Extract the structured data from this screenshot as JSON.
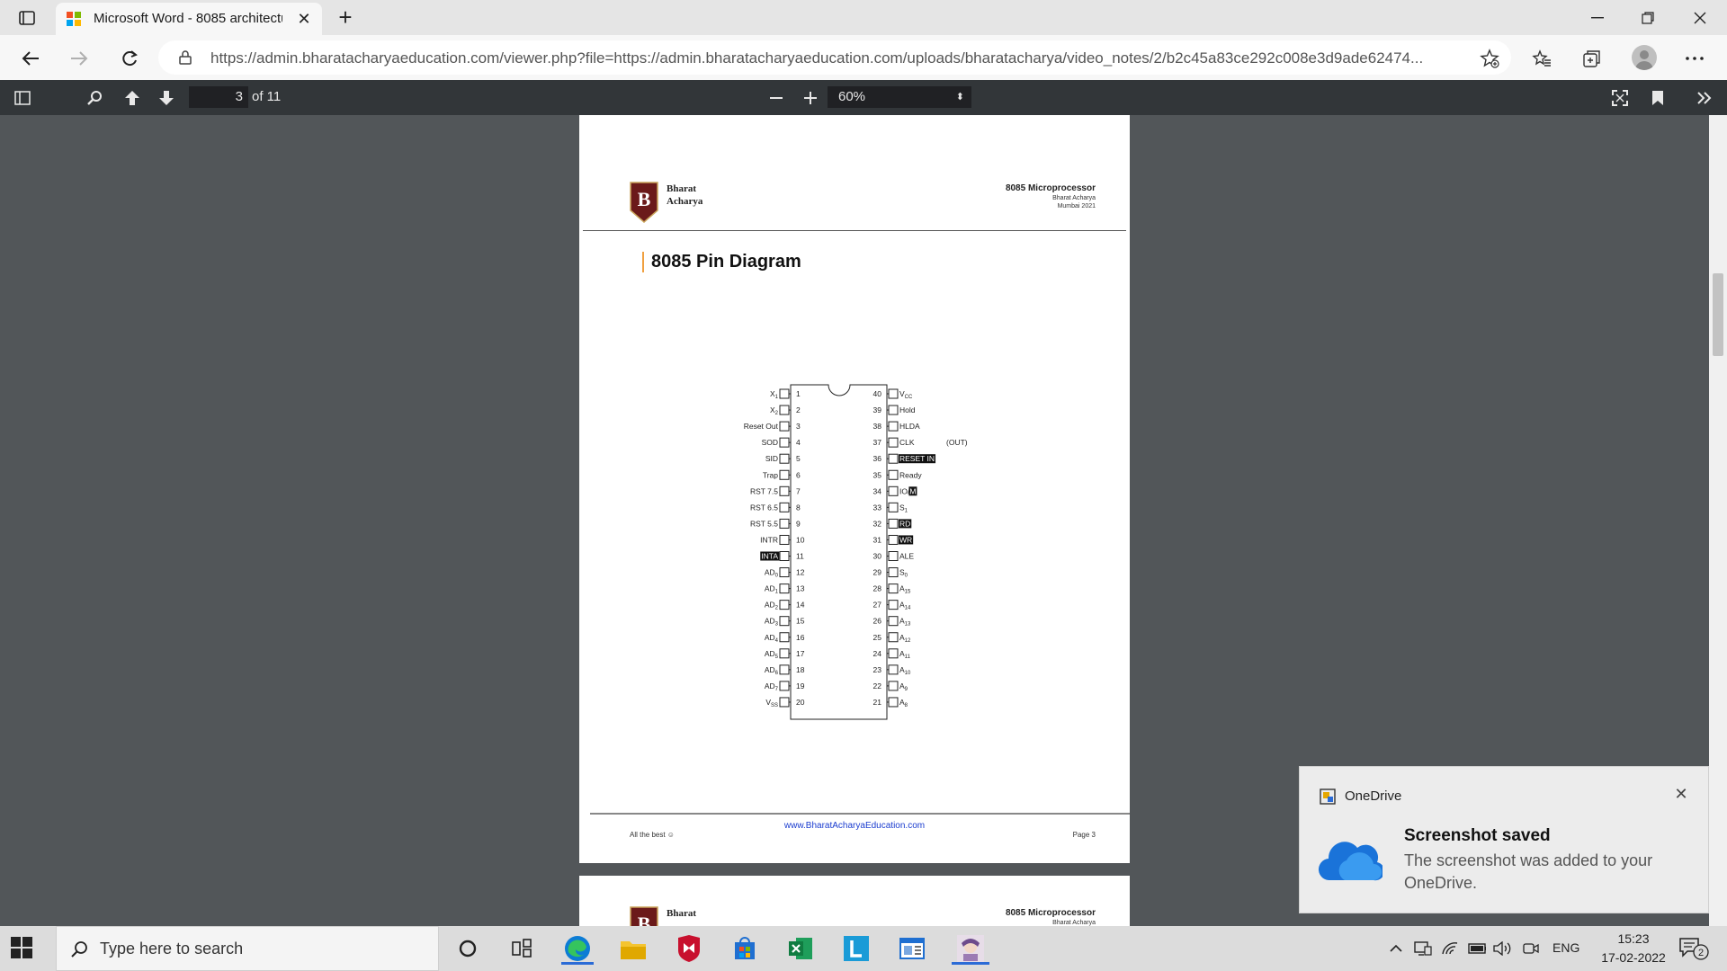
{
  "browser": {
    "tab_title": "Microsoft Word - 8085 architectu",
    "url": "https://admin.bharatacharyaeducation.com/viewer.php?file=https://admin.bharatacharyaeducation.com/uploads/bharatacharya/video_notes/2/b2c45a83ce292c008e3d9ade62474..."
  },
  "pdf_toolbar": {
    "page_number": "3",
    "page_total": "of 11",
    "zoom": "60%"
  },
  "pdf_page": {
    "logo_line1": "Bharat",
    "logo_line2": "Acharya",
    "header_title": "8085 Microprocessor",
    "header_author": "Bharat Acharya",
    "header_location": "Mumbai 2021",
    "heading": "8085 Pin Diagram",
    "footer_left": "All the best ☺",
    "footer_center": "www.BharatAcharyaEducation.com",
    "footer_right": "Page 3",
    "clk_note": "(OUT)",
    "left_pins": [
      {
        "num": "1",
        "label": "X1",
        "sub": true
      },
      {
        "num": "2",
        "label": "X2",
        "sub": true
      },
      {
        "num": "3",
        "label": "Reset Out"
      },
      {
        "num": "4",
        "label": "SOD"
      },
      {
        "num": "5",
        "label": "SID"
      },
      {
        "num": "6",
        "label": "Trap"
      },
      {
        "num": "7",
        "label": "RST 7.5"
      },
      {
        "num": "8",
        "label": "RST 6.5"
      },
      {
        "num": "9",
        "label": "RST 5.5"
      },
      {
        "num": "10",
        "label": "INTR"
      },
      {
        "num": "11",
        "label": "INTA",
        "inv": true
      },
      {
        "num": "12",
        "label": "AD0",
        "sub": true
      },
      {
        "num": "13",
        "label": "AD1",
        "sub": true
      },
      {
        "num": "14",
        "label": "AD2",
        "sub": true
      },
      {
        "num": "15",
        "label": "AD3",
        "sub": true
      },
      {
        "num": "16",
        "label": "AD4",
        "sub": true
      },
      {
        "num": "17",
        "label": "AD5",
        "sub": true
      },
      {
        "num": "18",
        "label": "AD6",
        "sub": true
      },
      {
        "num": "19",
        "label": "AD7",
        "sub": true
      },
      {
        "num": "20",
        "label": "VSS",
        "sub": true
      }
    ],
    "right_pins": [
      {
        "num": "40",
        "label": "VCC",
        "sub": true
      },
      {
        "num": "39",
        "label": "Hold"
      },
      {
        "num": "38",
        "label": "HLDA"
      },
      {
        "num": "37",
        "label": "CLK"
      },
      {
        "num": "36",
        "label": "RESET IN",
        "inv": true
      },
      {
        "num": "35",
        "label": "Ready"
      },
      {
        "num": "34",
        "label": "IO/M",
        "partinv": true
      },
      {
        "num": "33",
        "label": "S1",
        "sub": true
      },
      {
        "num": "32",
        "label": "RD",
        "inv": true
      },
      {
        "num": "31",
        "label": "WR",
        "inv": true
      },
      {
        "num": "30",
        "label": "ALE"
      },
      {
        "num": "29",
        "label": "S0",
        "sub": true
      },
      {
        "num": "28",
        "label": "A15",
        "sub": true
      },
      {
        "num": "27",
        "label": "A14",
        "sub": true
      },
      {
        "num": "26",
        "label": "A13",
        "sub": true
      },
      {
        "num": "25",
        "label": "A12",
        "sub": true
      },
      {
        "num": "24",
        "label": "A11",
        "sub": true
      },
      {
        "num": "23",
        "label": "A10",
        "sub": true
      },
      {
        "num": "22",
        "label": "A9",
        "sub": true
      },
      {
        "num": "21",
        "label": "A8",
        "sub": true
      }
    ],
    "next_page_logo": "Bharat",
    "next_page_header": "8085 Microprocessor",
    "next_page_author": "Bharat Acharya"
  },
  "toast": {
    "app": "OneDrive",
    "title": "Screenshot saved",
    "body": "The screenshot was added to your OneDrive."
  },
  "taskbar": {
    "search_placeholder": "Type here to search",
    "lang": "ENG",
    "time": "15:23",
    "date": "17-02-2022",
    "notif_count": "2"
  },
  "colors": {
    "accent": "#2b6bd6",
    "pdf_toolbar": "#323639",
    "pdf_bg": "#525659",
    "logo_maroon": "#6b1a1a",
    "link_blue": "#1a3ccf"
  }
}
